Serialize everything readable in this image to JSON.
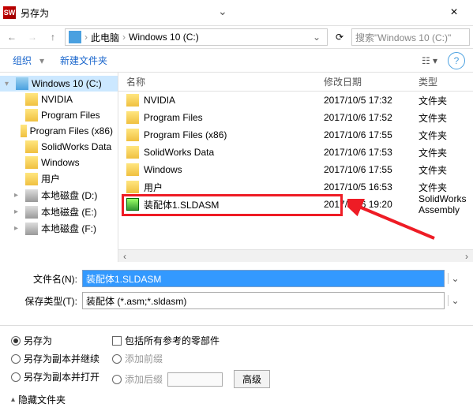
{
  "title": "另存为",
  "breadcrumb": {
    "root": "此电脑",
    "path": "Windows 10 (C:)"
  },
  "search": {
    "placeholder": "搜索\"Windows 10 (C:)\""
  },
  "toolbar": {
    "organize": "组织",
    "newfolder": "新建文件夹"
  },
  "columns": {
    "name": "名称",
    "date": "修改日期",
    "type": "类型"
  },
  "tree": [
    {
      "label": "Windows 10 (C:)",
      "icon": "drive-c",
      "selected": true,
      "root": true,
      "expander": "▾"
    },
    {
      "label": "NVIDIA",
      "icon": "folder"
    },
    {
      "label": "Program Files",
      "icon": "folder"
    },
    {
      "label": "Program Files (x86)",
      "icon": "folder"
    },
    {
      "label": "SolidWorks Data",
      "icon": "folder"
    },
    {
      "label": "Windows",
      "icon": "folder"
    },
    {
      "label": "用户",
      "icon": "folder"
    },
    {
      "label": "本地磁盘 (D:)",
      "icon": "drive",
      "expander": "▸"
    },
    {
      "label": "本地磁盘 (E:)",
      "icon": "drive",
      "expander": "▸"
    },
    {
      "label": "本地磁盘 (F:)",
      "icon": "drive",
      "expander": "▸"
    }
  ],
  "files": [
    {
      "name": "NVIDIA",
      "date": "2017/10/5 17:32",
      "type": "文件夹",
      "icon": "folder"
    },
    {
      "name": "Program Files",
      "date": "2017/10/6 17:52",
      "type": "文件夹",
      "icon": "folder"
    },
    {
      "name": "Program Files (x86)",
      "date": "2017/10/6 17:55",
      "type": "文件夹",
      "icon": "folder"
    },
    {
      "name": "SolidWorks Data",
      "date": "2017/10/6 17:53",
      "type": "文件夹",
      "icon": "folder"
    },
    {
      "name": "Windows",
      "date": "2017/10/6 17:55",
      "type": "文件夹",
      "icon": "folder"
    },
    {
      "name": "用户",
      "date": "2017/10/5 16:53",
      "type": "文件夹",
      "icon": "folder"
    },
    {
      "name": "装配体1.SLDASM",
      "date": "2017/10/6 19:20",
      "type": "SolidWorks Assembly",
      "icon": "asm"
    }
  ],
  "form": {
    "fname_label": "文件名(N):",
    "fname_value": "装配体1.SLDASM",
    "ftype_label": "保存类型(T):",
    "ftype_value": "装配体 (*.asm;*.sldasm)"
  },
  "opts": {
    "saveas": "另存为",
    "saveas_copy_cont": "另存为副本并继续",
    "saveas_copy_open": "另存为副本并打开",
    "include_refs": "包括所有参考的零部件",
    "add_prefix": "添加前缀",
    "add_suffix": "添加后缀",
    "advanced": "高级",
    "hide_folders": "隐藏文件夹"
  }
}
